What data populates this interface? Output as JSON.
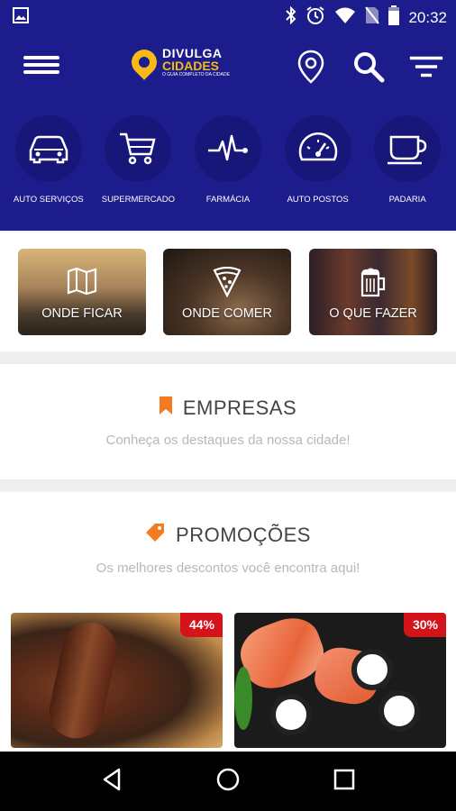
{
  "status_bar": {
    "time": "20:32",
    "notification_icon": "image-icon"
  },
  "app_bar": {
    "logo_line1": "DIVULGA",
    "logo_line2": "CIDADES",
    "logo_tagline": "O GUIA COMPLETO DA CIDADE"
  },
  "categories": [
    {
      "label": "AUTO SERVIÇOS",
      "icon": "car-icon"
    },
    {
      "label": "SUPERMERCADO",
      "icon": "cart-icon"
    },
    {
      "label": "FARMÁCIA",
      "icon": "pulse-icon"
    },
    {
      "label": "AUTO POSTOS",
      "icon": "gauge-icon"
    },
    {
      "label": "PADARIA",
      "icon": "cup-icon"
    }
  ],
  "quick_cards": [
    {
      "label": "ONDE FICAR",
      "icon": "map-icon"
    },
    {
      "label": "ONDE COMER",
      "icon": "pizza-icon"
    },
    {
      "label": "O QUE FAZER",
      "icon": "beer-icon"
    }
  ],
  "empresas": {
    "title": "EMPRESAS",
    "subtitle": "Conheça os destaques da nossa cidade!"
  },
  "promocoes": {
    "title": "PROMOÇÕES",
    "subtitle": "Os melhores descontos você encontra aqui!"
  },
  "promos": [
    {
      "badge": "44%",
      "image": "churrasco"
    },
    {
      "badge": "30%",
      "image": "sushi"
    }
  ],
  "colors": {
    "primary": "#1c1c8c",
    "accent": "#f47c20",
    "badge": "#d5131b",
    "logo_yellow": "#f6b916"
  }
}
